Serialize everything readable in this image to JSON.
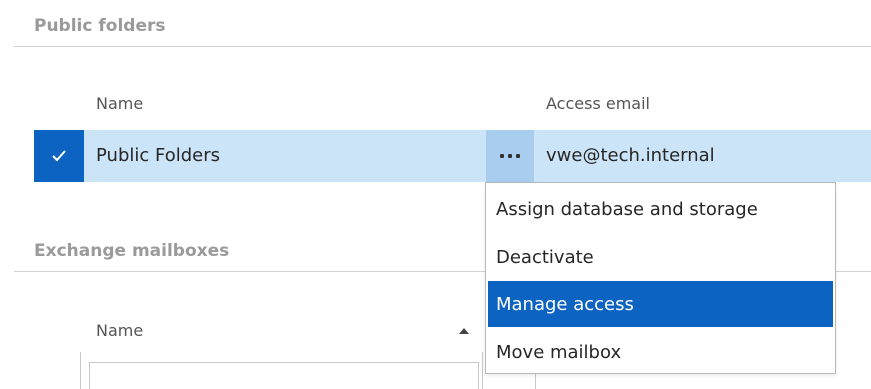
{
  "public_folders": {
    "section_title": "Public folders",
    "columns": {
      "name": "Name",
      "access_email": "Access email"
    },
    "rows": [
      {
        "name": "Public Folders",
        "access_email": "vwe@tech.internal",
        "selected": true
      }
    ],
    "row_actions_icon": "ellipsis-icon"
  },
  "context_menu": {
    "items": [
      {
        "label": "Assign database and storage"
      },
      {
        "label": "Deactivate"
      },
      {
        "label": "Manage access",
        "highlighted": true
      },
      {
        "label": "Move mailbox"
      }
    ]
  },
  "exchange_mailboxes": {
    "section_title": "Exchange mailboxes",
    "columns": {
      "name": "Name"
    },
    "sort": "ascending"
  },
  "colors": {
    "selection_accent": "#0d63c1",
    "row_highlight": "#cce4f7",
    "ellipsis_cell": "#a8cdee",
    "section_title": "#9a9a9a"
  }
}
